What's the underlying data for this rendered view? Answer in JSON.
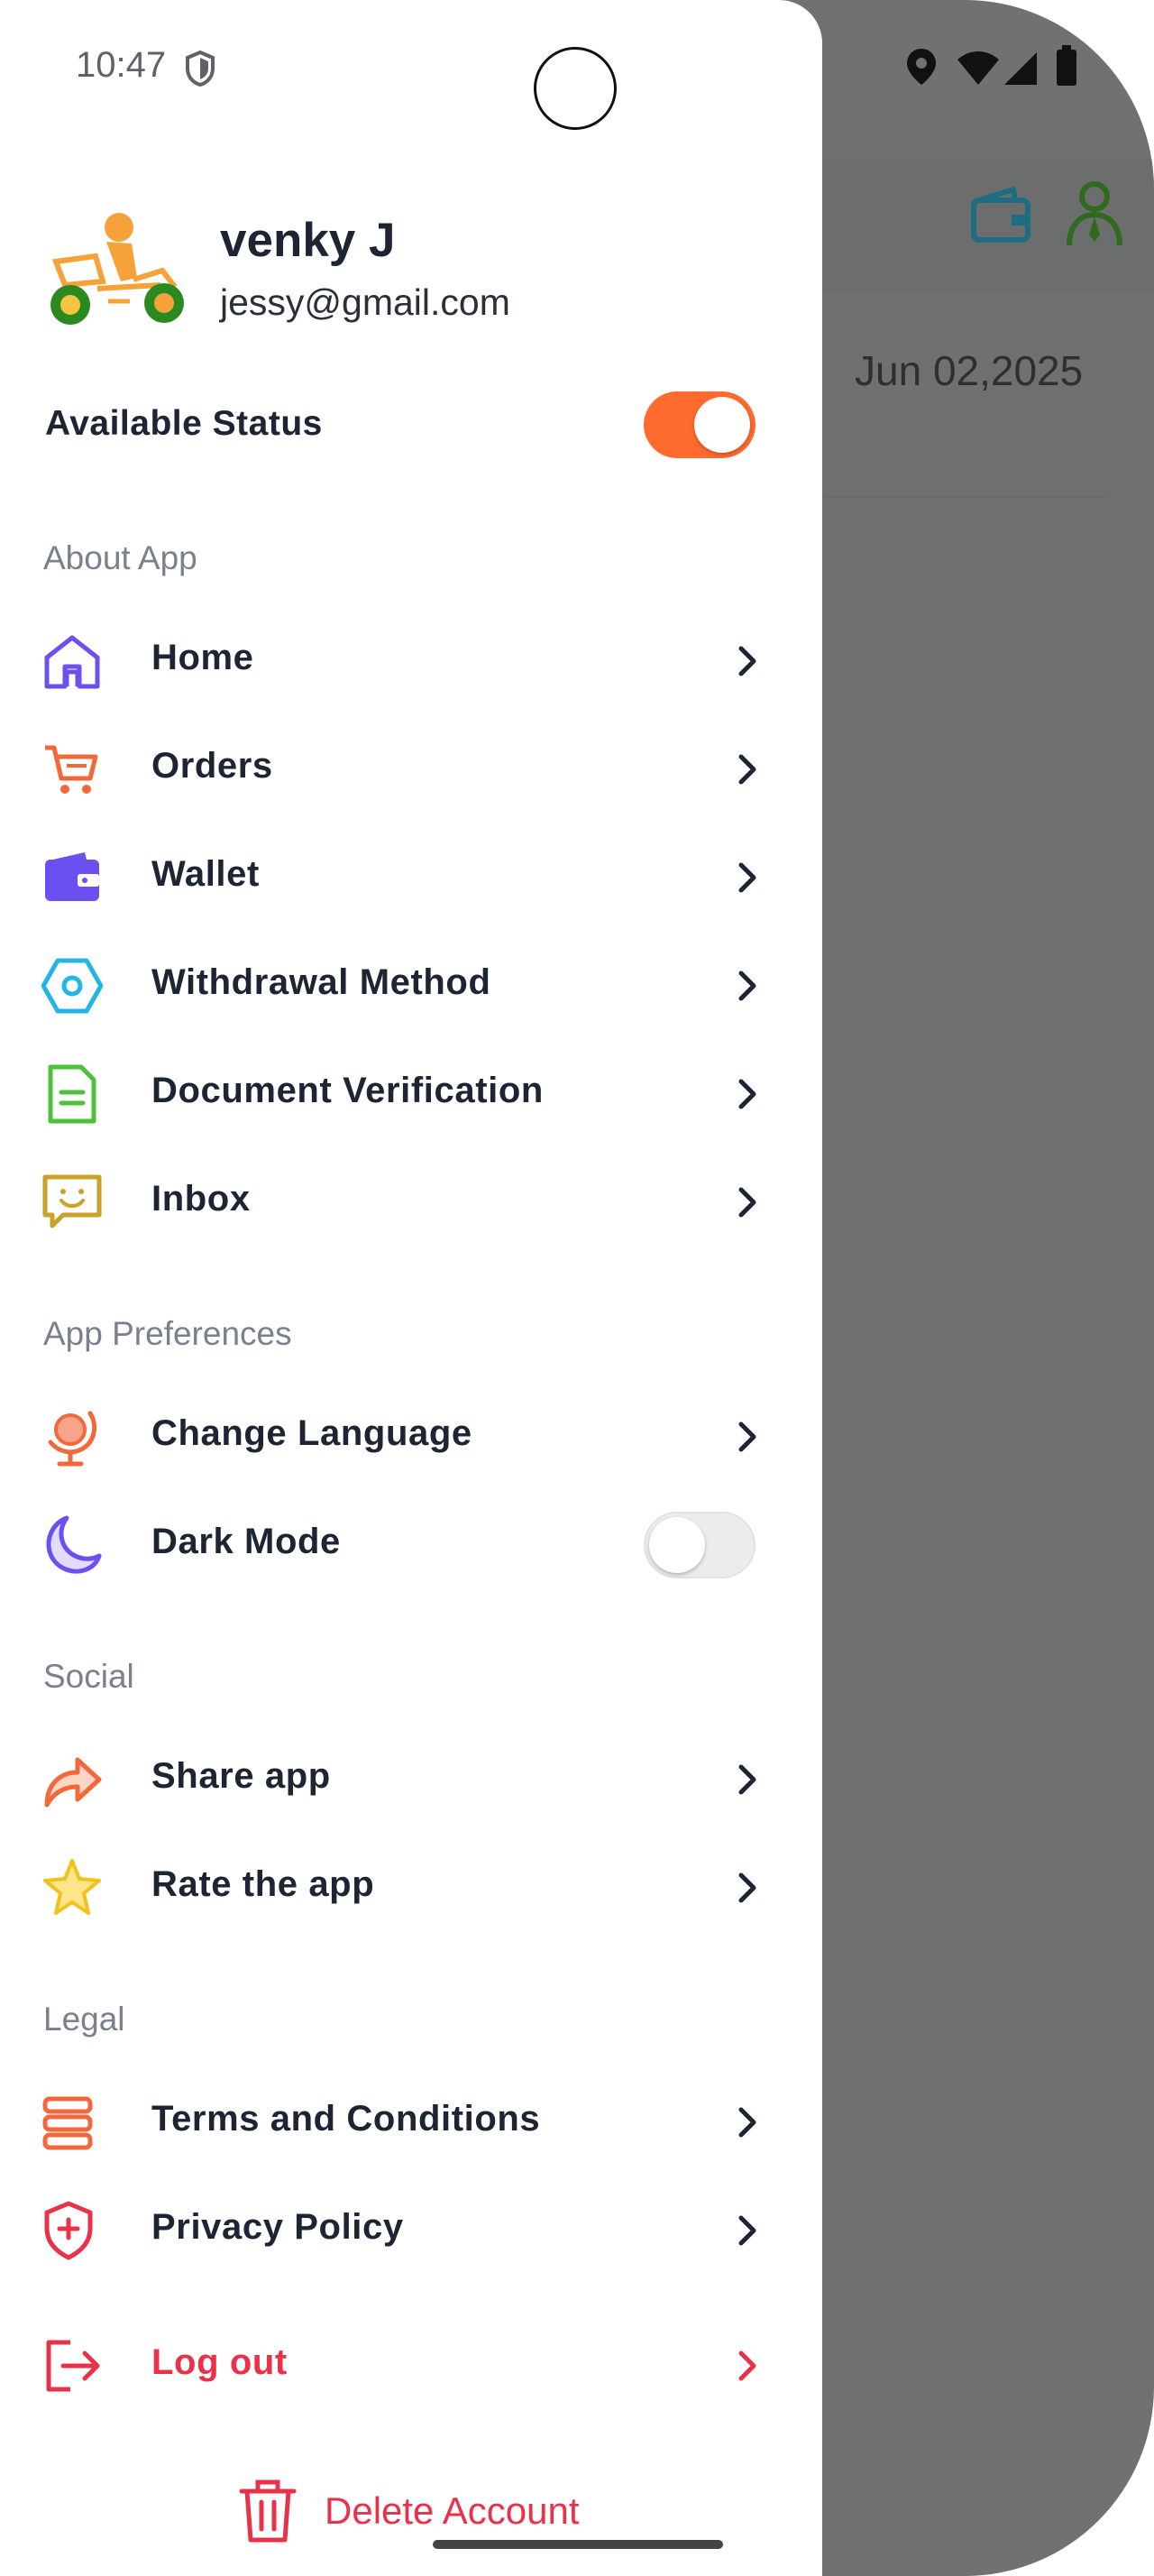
{
  "status_bar": {
    "time": "10:47"
  },
  "background": {
    "date": "Jun 02,2025"
  },
  "profile": {
    "name": "venky J",
    "email": "jessy@gmail.com"
  },
  "availability": {
    "label": "Available Status",
    "enabled": true
  },
  "sections": {
    "about": "About App",
    "preferences": "App Preferences",
    "social": "Social",
    "legal": "Legal"
  },
  "menu": {
    "home": "Home",
    "orders": "Orders",
    "wallet": "Wallet",
    "withdrawal": "Withdrawal Method",
    "documents": "Document Verification",
    "inbox": "Inbox",
    "language": "Change Language",
    "dark_mode": "Dark Mode",
    "share": "Share app",
    "rate": "Rate the app",
    "terms": "Terms and Conditions",
    "privacy": "Privacy Policy",
    "logout": "Log out"
  },
  "dark_mode_enabled": false,
  "delete_account": "Delete Account",
  "colors": {
    "accent_orange": "#ff6a2f",
    "danger_red": "#e8324a",
    "purple": "#6b4ff0",
    "overlay": "#707171"
  },
  "icons": [
    "home-icon",
    "cart-icon",
    "wallet-icon",
    "hexagon-icon",
    "document-icon",
    "chat-icon",
    "globe-icon",
    "moon-icon",
    "share-icon",
    "star-icon",
    "terms-icon",
    "shield-plus-icon",
    "logout-icon",
    "trash-icon"
  ]
}
